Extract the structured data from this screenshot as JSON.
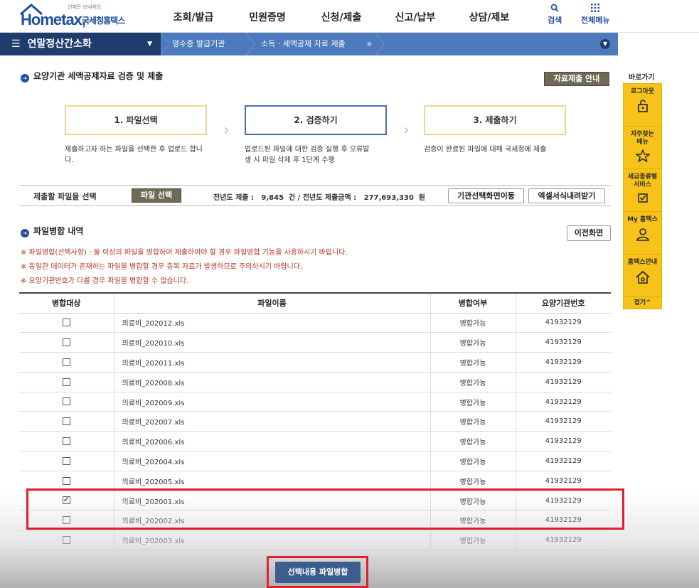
{
  "header": {
    "logo_tagline": "언제든 보내세요",
    "logo_main": "Hometax,",
    "logo_sub": "국세청홈택스",
    "nav": [
      "조회/발급",
      "민원증명",
      "신청/제출",
      "신고/납부",
      "상담/제보"
    ],
    "search_label": "검색",
    "allmenu_label": "전체메뉴"
  },
  "breadcrumb": {
    "main": "연말정산간소화",
    "items": [
      "영수증 발급기관",
      "소득 · 세액공제 자료 제출"
    ]
  },
  "quick": {
    "title": "바로가기",
    "items": [
      {
        "label": "로그아웃",
        "icon": "lock-icon"
      },
      {
        "label": "자주찾는 메뉴",
        "icon": "star-icon"
      },
      {
        "label": "세금종류별 서비스",
        "icon": "check-icon"
      },
      {
        "label": "My 홈택스",
        "icon": "person-icon"
      },
      {
        "label": "홈택스안내",
        "icon": "home-icon"
      }
    ],
    "fold": "접기^"
  },
  "section1": {
    "title": "요양기관 세액공제자료 검증 및 제출",
    "guide_button": "자료제출 안내"
  },
  "steps": [
    {
      "label": "1. 파일선택",
      "desc": "제출하고자 하는 파일을 선택한 후 업로드 합니다."
    },
    {
      "label": "2. 검증하기",
      "desc": "업로드된 파일에 대한 검증 실행 후 오류발생 시 파일 삭제 후 1단계 수행"
    },
    {
      "label": "3. 제출하기",
      "desc": "검증이 완료된 파일에 대해 국세청에 제출"
    }
  ],
  "filebar": {
    "label": "제출할 파일을 선택",
    "select_button": "파일 선택",
    "stats": "전년도 제출 :   9,845  건 / 전년도 제출금액 :   277,693,330  원",
    "org_button": "기관선택화면이동",
    "excel_button": "엑셀서식내려받기"
  },
  "section2": {
    "title": "파일병합 내역",
    "prev_button": "이전화면"
  },
  "notes": [
    "※ 파일병합(선택사항) : 둘 이상의 파일을 병합하여 제출하여야 할 경우 파일병합 기능을 사용하시기 바랍니다.",
    "※ 동일한 데이터가 존재하는 파일을 병합할 경우 중복 자료가 발생하므로 주의하시기 바랍니다.",
    "※ 요양기관번호가 다를 경우 파일을 병합할 수 없습니다."
  ],
  "table": {
    "headers": [
      "병합대상",
      "파일이름",
      "병합여부",
      "요양기관번호"
    ],
    "rows": [
      {
        "checked": false,
        "file": "의료비_202012.xls",
        "status": "병합가능",
        "code": "41932129"
      },
      {
        "checked": false,
        "file": "의료비_202010.xls",
        "status": "병합가능",
        "code": "41932129"
      },
      {
        "checked": false,
        "file": "의료비_202011.xls",
        "status": "병합가능",
        "code": "41932129"
      },
      {
        "checked": false,
        "file": "의료비_202008.xls",
        "status": "병합가능",
        "code": "41932129"
      },
      {
        "checked": false,
        "file": "의료비_202009.xls",
        "status": "병합가능",
        "code": "41932129"
      },
      {
        "checked": false,
        "file": "의료비_202007.xls",
        "status": "병합가능",
        "code": "41932129"
      },
      {
        "checked": false,
        "file": "의료비_202006.xls",
        "status": "병합가능",
        "code": "41932129"
      },
      {
        "checked": false,
        "file": "의료비_202004.xls",
        "status": "병합가능",
        "code": "41932129"
      },
      {
        "checked": false,
        "file": "의료비_202005.xls",
        "status": "병합가능",
        "code": "41932129"
      },
      {
        "checked": true,
        "file": "의료비_202001.xls",
        "status": "병합가능",
        "code": "41932129"
      },
      {
        "checked": false,
        "file": "의료비_202002.xls",
        "status": "병합가능",
        "code": "41932129"
      },
      {
        "checked": false,
        "file": "의료비_202003.xls",
        "status": "병합가능",
        "code": "41932129"
      }
    ]
  },
  "merge_button": "선택내용 파일병합",
  "colors": {
    "brand": "#1f4fa2",
    "navy": "#1f3c6f",
    "bar": "#4d79bd",
    "quick": "#f7c21a",
    "highlight": "#e0202a",
    "note": "#b6341f"
  }
}
